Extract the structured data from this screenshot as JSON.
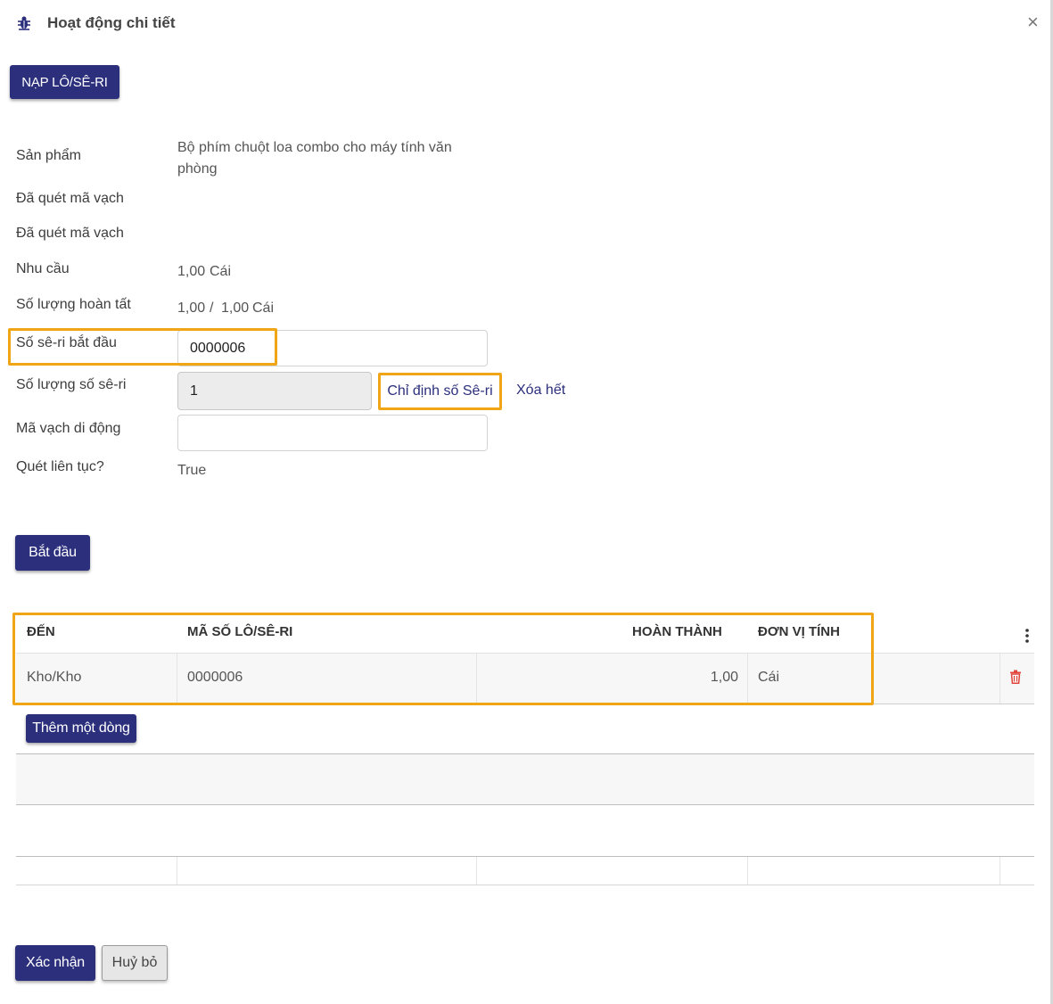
{
  "dialog": {
    "title": "Hoạt động chi tiết",
    "close": "×",
    "title_icon": "bug-icon"
  },
  "toolbar": {
    "load_lot_serial": "NẠP LÔ/SÊ-RI"
  },
  "form": {
    "product_label": "Sản phẩm",
    "product_value_line1": "Bộ phím chuột loa combo cho máy tính văn",
    "product_value_line2": "phòng",
    "scanned_label_1": "Đã quét mã vạch",
    "scanned_label_2": "Đã quét mã vạch",
    "demand_label": "Nhu cầu",
    "demand_qty": "1,00",
    "demand_uom": "Cái",
    "done_qty_label": "Số lượng hoàn tất",
    "done_qty": "1,00",
    "done_sep": "/",
    "done_total": "1,00",
    "done_uom": "Cái",
    "start_serial_label": "Số sê-ri bắt đầu",
    "start_serial_value": "0000006",
    "serial_count_label": "Số lượng số sê-ri",
    "serial_count_value": "1",
    "assign_serial_button": "Chỉ định số Sê-ri",
    "clear_all_button": "Xóa hết",
    "mobile_barcode_label": "Mã vạch di động",
    "mobile_barcode_value": "",
    "continuous_scan_label": "Quét liên tục?",
    "continuous_scan_value": "True"
  },
  "start_button": "Bắt đầu",
  "table": {
    "columns": [
      "ĐẾN",
      "MÃ SỐ LÔ/SÊ-RI",
      "HOÀN THÀNH",
      "ĐƠN VỊ TÍNH"
    ],
    "rows": [
      {
        "to": "Kho/Kho",
        "lot": "0000006",
        "done": "1,00",
        "uom": "Cái"
      }
    ],
    "add_line": "Thêm một dòng"
  },
  "footer": {
    "confirm": "Xác nhận",
    "cancel": "Huỷ bỏ"
  },
  "colors": {
    "primary": "#2b2f7c",
    "highlight": "#f0a517",
    "delete": "#e0443a"
  }
}
